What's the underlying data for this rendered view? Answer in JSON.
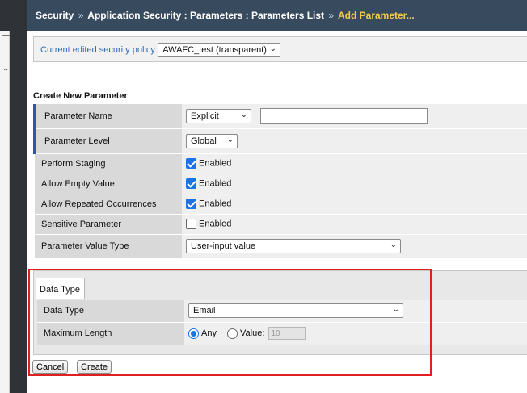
{
  "breadcrumb": {
    "items": [
      "Security",
      "Application Security : Parameters : Parameters List"
    ],
    "separator": "»",
    "current": "Add Parameter..."
  },
  "policy": {
    "label": "Current edited security policy",
    "selected": "AWAFC_test (transparent)"
  },
  "form": {
    "title": "Create New Parameter",
    "parameter_name": {
      "label": "Parameter Name",
      "type_selected": "Explicit",
      "value": ""
    },
    "parameter_level": {
      "label": "Parameter Level",
      "selected": "Global"
    },
    "perform_staging": {
      "label": "Perform Staging",
      "checkbox_label": "Enabled",
      "checked": true
    },
    "allow_empty": {
      "label": "Allow Empty Value",
      "checkbox_label": "Enabled",
      "checked": true
    },
    "allow_repeated": {
      "label": "Allow Repeated Occurrences",
      "checkbox_label": "Enabled",
      "checked": true
    },
    "sensitive": {
      "label": "Sensitive Parameter",
      "checkbox_label": "Enabled",
      "checked": false
    },
    "value_type": {
      "label": "Parameter Value Type",
      "selected": "User-input value"
    }
  },
  "data_type_panel": {
    "tab_label": "Data Type",
    "data_type": {
      "label": "Data Type",
      "selected": "Email"
    },
    "max_length": {
      "label": "Maximum Length",
      "any_label": "Any",
      "value_label": "Value:",
      "value": "10",
      "selected": "Any"
    }
  },
  "buttons": {
    "cancel": "Cancel",
    "create": "Create"
  },
  "colors": {
    "header_bg": "#384a5e",
    "current_crumb": "#f2c94c",
    "highlight_box": "#e02020",
    "checkbox_on": "#1a73e8"
  }
}
